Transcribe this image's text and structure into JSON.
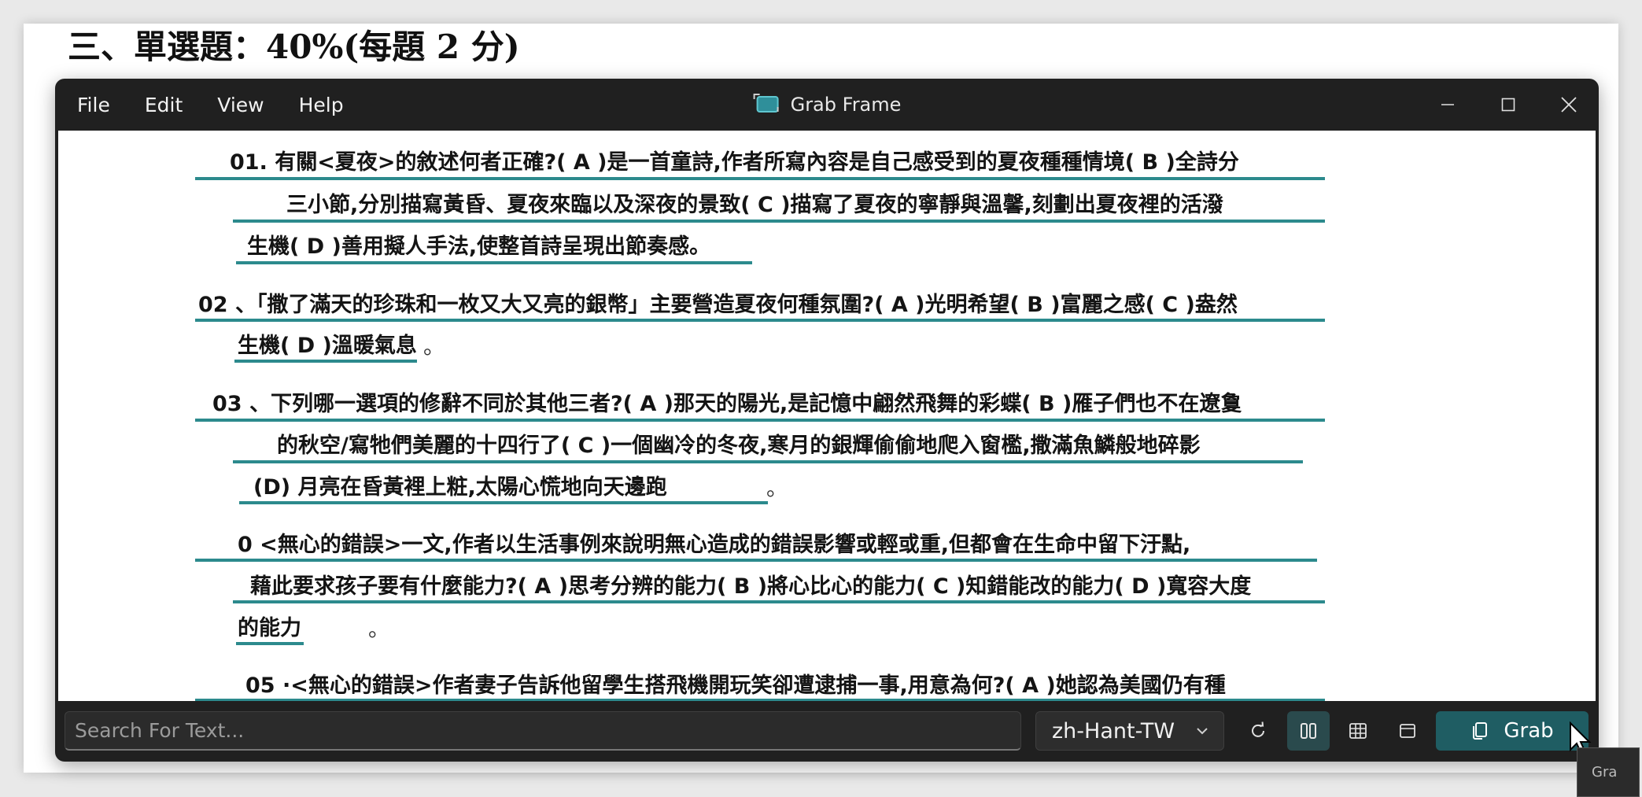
{
  "document": {
    "heading": "三、單選題：40%(每題 2 分)"
  },
  "window": {
    "title": "Grab Frame",
    "menu": [
      "File",
      "Edit",
      "View",
      "Help"
    ]
  },
  "content": {
    "lines": [
      "01. 有關<夏夜>的敘述何者正確?( A )是一首童詩,作者所寫內容是自己感受到的夏夜種種情境( B )全詩分",
      "三小節,分別描寫黃昏、夏夜來臨以及深夜的景致( C )描寫了夏夜的寧靜與溫馨,刻劃出夏夜裡的活潑",
      "生機( D )善用擬人手法,使整首詩呈現出節奏感。",
      "02 、「撒了滿天的珍珠和一枚又大又亮的銀幣」主要營造夏夜何種氛圍?( A )光明希望( B )富麗之感( C )盎然",
      "生機( D )溫暖氣息",
      "03 、下列哪一選項的修辭不同於其他三者?( A )那天的陽光,是記憶中翩然飛舞的彩蝶( B )雁子們也不在遼敻",
      "的秋空/寫牠們美麗的十四行了( C )一個幽冷的冬夜,寒月的銀輝偷偷地爬入窗檻,撒滿魚鱗般地碎影",
      "(D) 月亮在昏黃裡上粧,太陽心慌地向天邊跑",
      "0 <無心的錯誤>一文,作者以生活事例來說明無心造成的錯誤影響或輕或重,但都會在生命中留下汙點,",
      "藉此要求孩子要有什麼能力?( A )思考分辨的能力( B )將心比心的能力( C )知錯能改的能力( D )寬容大度",
      "的能力",
      "05 ·<無心的錯誤>作者妻子告訴他留學生搭飛機開玩笑卻遭逮捕一事,用意為何?( A )她認為美國仍有種"
    ],
    "period": "。"
  },
  "toolbar": {
    "search_placeholder": "Search For Text...",
    "language": "zh-Hant-TW",
    "grab_label": "Grab",
    "tooltip_text": "Gra"
  },
  "colors": {
    "accent": "#1f5d63",
    "underline": "#2c8a8d",
    "window_bg": "#202020"
  }
}
